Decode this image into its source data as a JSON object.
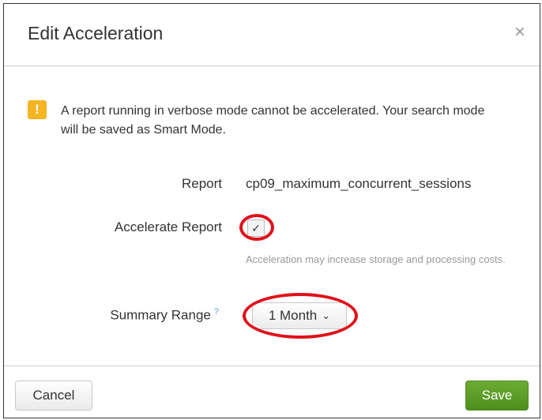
{
  "dialog": {
    "title": "Edit Acceleration",
    "close_glyph": "×",
    "close_icon": "close-icon"
  },
  "warning": {
    "icon": "warning-icon",
    "icon_glyph": "!",
    "icon_color": "#f5b523",
    "text": "A report running in verbose mode cannot be accelerated. Your search mode will be saved as Smart Mode."
  },
  "form": {
    "report_label": "Report",
    "report_value": "cp09_maximum_concurrent_sessions",
    "accelerate_label": "Accelerate Report",
    "accelerate_checked": true,
    "check_glyph": "✓",
    "accelerate_help": "Acceleration may increase storage and processing costs.",
    "summary_range_label": "Summary Range",
    "summary_range_help_marker": "?",
    "summary_range_value": "1 Month",
    "chevron_glyph": "⌄"
  },
  "footer": {
    "cancel_label": "Cancel",
    "save_label": "Save",
    "save_color": "#5c9e2a"
  },
  "annotations": {
    "highlight_color": "#e0111b"
  }
}
